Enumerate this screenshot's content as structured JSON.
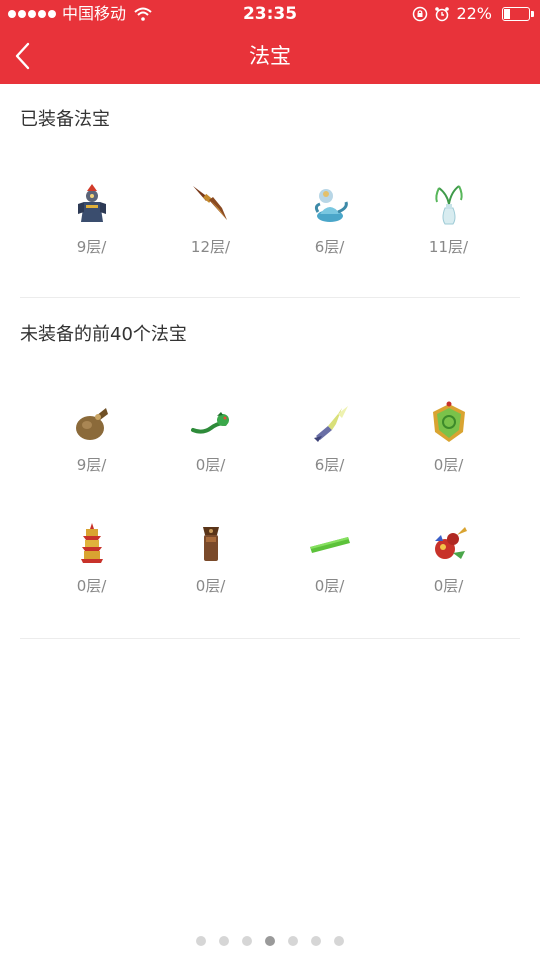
{
  "status_bar": {
    "carrier": "中国移动",
    "time": "23:35",
    "battery_percent": "22%",
    "battery_level": 0.22
  },
  "nav": {
    "title": "法宝",
    "back_icon": "chevron-left-icon",
    "bar_color": "#e8333a"
  },
  "equipped": {
    "title": "已装备法宝",
    "items": [
      {
        "icon": "armored-warrior-icon",
        "level": "9层/"
      },
      {
        "icon": "dagger-icon",
        "level": "12层/"
      },
      {
        "icon": "genie-lamp-icon",
        "level": "6层/"
      },
      {
        "icon": "willow-vase-icon",
        "level": "11层/"
      }
    ]
  },
  "unequipped": {
    "title": "未装备的前40个法宝",
    "items": [
      {
        "icon": "money-bag-icon",
        "level": "9层/"
      },
      {
        "icon": "jade-dragon-icon",
        "level": "0层/"
      },
      {
        "icon": "lightning-blade-icon",
        "level": "6层/"
      },
      {
        "icon": "jade-token-icon",
        "level": "0层/"
      },
      {
        "icon": "pagoda-icon",
        "level": "0层/"
      },
      {
        "icon": "bronze-seal-icon",
        "level": "0层/"
      },
      {
        "icon": "green-ruler-icon",
        "level": "0层/"
      },
      {
        "icon": "magic-gourd-icon",
        "level": "0层/"
      }
    ]
  },
  "pager": {
    "count": 7,
    "active_index": 3
  }
}
